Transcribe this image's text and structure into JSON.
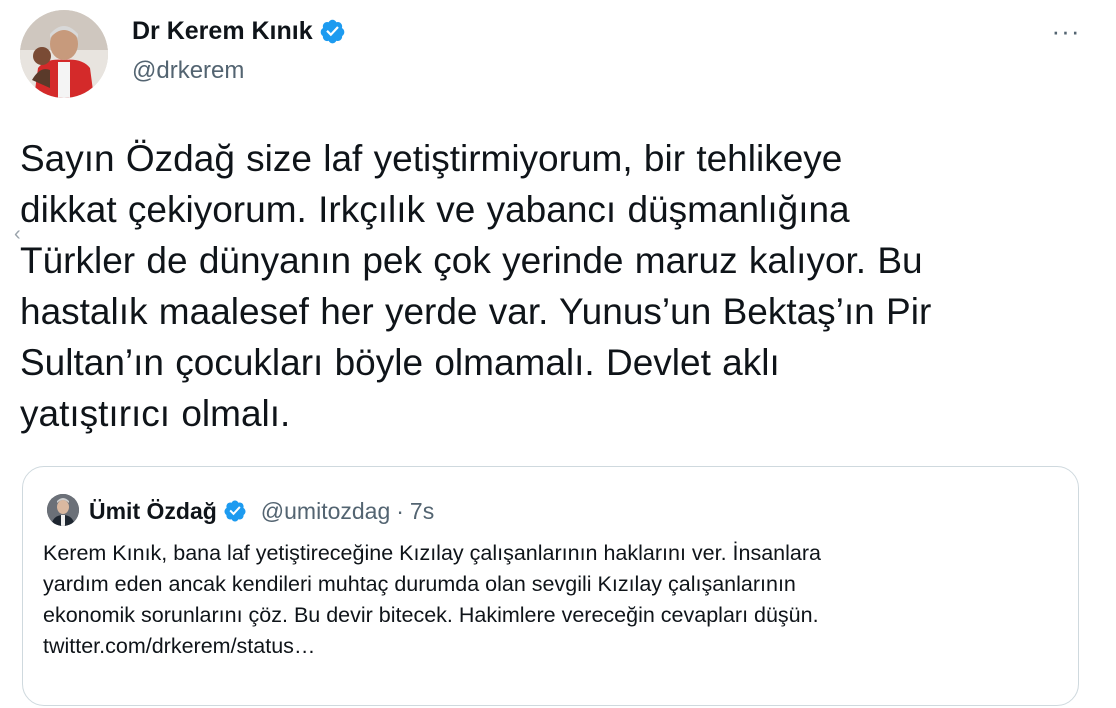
{
  "tweet": {
    "author": {
      "name": "Dr Kerem Kınık",
      "handle": "@drkerem",
      "verified": true
    },
    "more_icon": "more-horizontal-icon",
    "more_label": "···",
    "text": "Sayın Özdağ size laf yetiştirmiyorum, bir tehlikeye\ndikkat çekiyorum. Irkçılık ve yabancı düşmanlığına\nTürkler de dünyanın pek çok yerinde maruz kalıyor. Bu\nhastalık maalesef her yerde var. Yunus’un Bektaş’ın Pir\nSultan’ın çocukları böyle olmamalı. Devlet aklı\nyatıştırıcı olmalı."
  },
  "quote": {
    "author": {
      "name": "Ümit Özdağ",
      "handle": "@umitozdag",
      "verified": true
    },
    "separator": "·",
    "time": "7s",
    "text": "Kerem Kınık, bana laf yetiştireceğine Kızılay çalışanlarının haklarını ver. İnsanlara\nyardım eden ancak kendileri muhtaç durumda olan sevgili Kızılay çalışanlarının\nekonomik sorunlarını çöz. Bu devir bitecek. Hakimlere vereceğin cevapları düşün.\ntwitter.com/drkerem/status…"
  },
  "ui": {
    "chevron": "‹"
  },
  "colors": {
    "text_primary": "#0f1419",
    "text_secondary": "#536471",
    "verified_blue": "#1d9bf0",
    "border": "#cfd9de"
  }
}
